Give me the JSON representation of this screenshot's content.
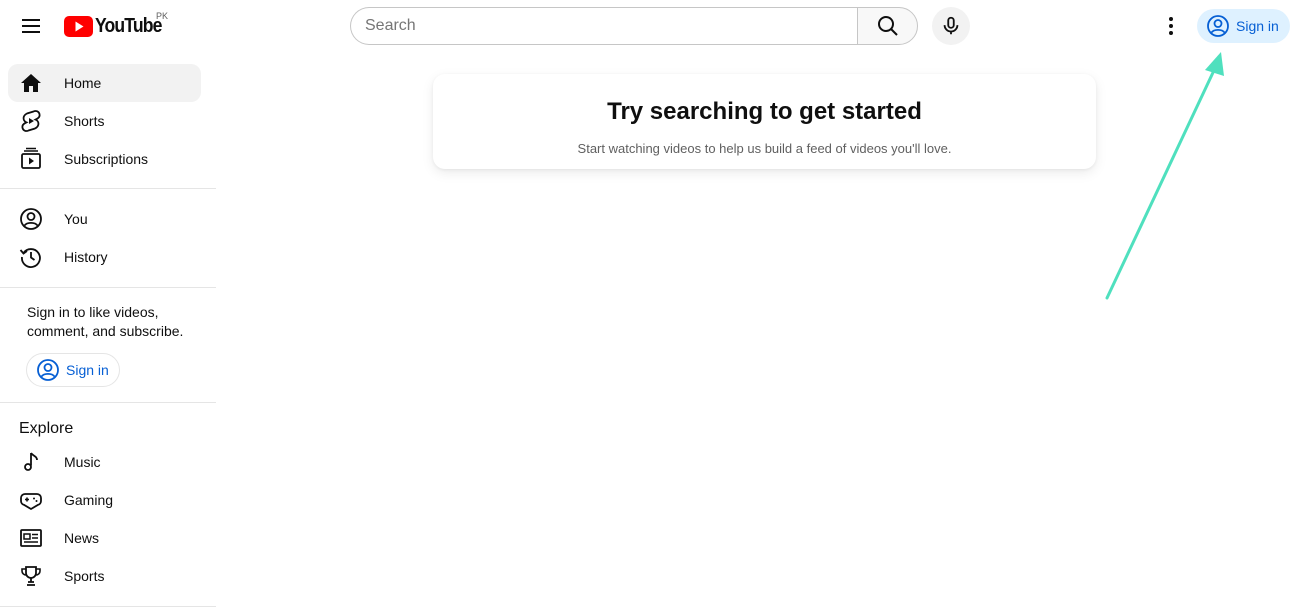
{
  "header": {
    "logo_text": "YouTube",
    "region": "PK",
    "search_placeholder": "Search",
    "sign_in_label": "Sign in"
  },
  "sidebar": {
    "primary": [
      {
        "label": "Home",
        "icon": "home-icon",
        "active": true
      },
      {
        "label": "Shorts",
        "icon": "shorts-icon"
      },
      {
        "label": "Subscriptions",
        "icon": "subscriptions-icon"
      }
    ],
    "you": [
      {
        "label": "You",
        "icon": "you-icon"
      },
      {
        "label": "History",
        "icon": "history-icon"
      }
    ],
    "signin_prompt": "Sign in to like videos, comment, and subscribe.",
    "signin_label": "Sign in",
    "explore_title": "Explore",
    "explore": [
      {
        "label": "Music",
        "icon": "music-icon"
      },
      {
        "label": "Gaming",
        "icon": "gaming-icon"
      },
      {
        "label": "News",
        "icon": "news-icon"
      },
      {
        "label": "Sports",
        "icon": "sports-icon"
      }
    ]
  },
  "main": {
    "title": "Try searching to get started",
    "subtitle": "Start watching videos to help us build a feed of videos you'll love."
  },
  "colors": {
    "brand_red": "#ff0000",
    "link_blue": "#065fd4",
    "signin_bg": "#def1ff",
    "annotation_arrow": "#4fe0be"
  }
}
